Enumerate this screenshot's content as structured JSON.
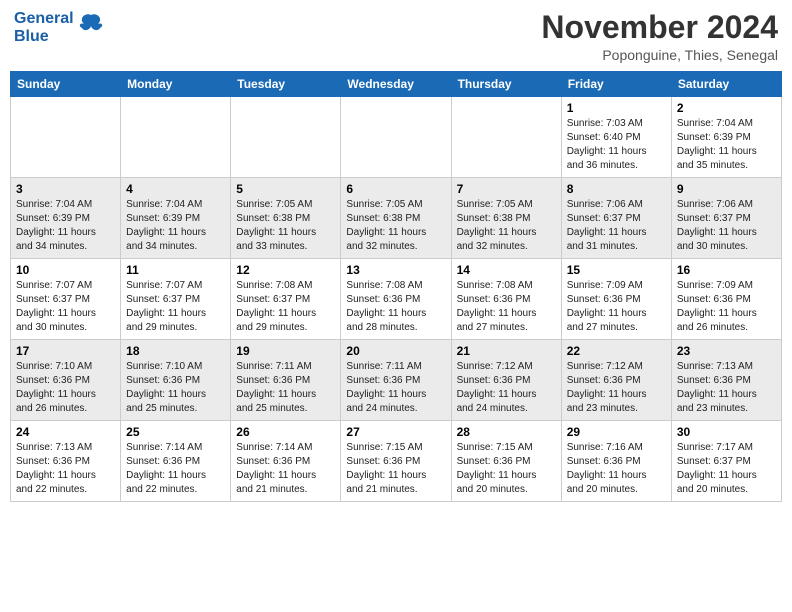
{
  "header": {
    "logo_line1": "General",
    "logo_line2": "Blue",
    "month": "November 2024",
    "location": "Poponguine, Thies, Senegal"
  },
  "days_of_week": [
    "Sunday",
    "Monday",
    "Tuesday",
    "Wednesday",
    "Thursday",
    "Friday",
    "Saturday"
  ],
  "weeks": [
    [
      {
        "day": "",
        "info": ""
      },
      {
        "day": "",
        "info": ""
      },
      {
        "day": "",
        "info": ""
      },
      {
        "day": "",
        "info": ""
      },
      {
        "day": "",
        "info": ""
      },
      {
        "day": "1",
        "info": "Sunrise: 7:03 AM\nSunset: 6:40 PM\nDaylight: 11 hours and 36 minutes."
      },
      {
        "day": "2",
        "info": "Sunrise: 7:04 AM\nSunset: 6:39 PM\nDaylight: 11 hours and 35 minutes."
      }
    ],
    [
      {
        "day": "3",
        "info": "Sunrise: 7:04 AM\nSunset: 6:39 PM\nDaylight: 11 hours and 34 minutes."
      },
      {
        "day": "4",
        "info": "Sunrise: 7:04 AM\nSunset: 6:39 PM\nDaylight: 11 hours and 34 minutes."
      },
      {
        "day": "5",
        "info": "Sunrise: 7:05 AM\nSunset: 6:38 PM\nDaylight: 11 hours and 33 minutes."
      },
      {
        "day": "6",
        "info": "Sunrise: 7:05 AM\nSunset: 6:38 PM\nDaylight: 11 hours and 32 minutes."
      },
      {
        "day": "7",
        "info": "Sunrise: 7:05 AM\nSunset: 6:38 PM\nDaylight: 11 hours and 32 minutes."
      },
      {
        "day": "8",
        "info": "Sunrise: 7:06 AM\nSunset: 6:37 PM\nDaylight: 11 hours and 31 minutes."
      },
      {
        "day": "9",
        "info": "Sunrise: 7:06 AM\nSunset: 6:37 PM\nDaylight: 11 hours and 30 minutes."
      }
    ],
    [
      {
        "day": "10",
        "info": "Sunrise: 7:07 AM\nSunset: 6:37 PM\nDaylight: 11 hours and 30 minutes."
      },
      {
        "day": "11",
        "info": "Sunrise: 7:07 AM\nSunset: 6:37 PM\nDaylight: 11 hours and 29 minutes."
      },
      {
        "day": "12",
        "info": "Sunrise: 7:08 AM\nSunset: 6:37 PM\nDaylight: 11 hours and 29 minutes."
      },
      {
        "day": "13",
        "info": "Sunrise: 7:08 AM\nSunset: 6:36 PM\nDaylight: 11 hours and 28 minutes."
      },
      {
        "day": "14",
        "info": "Sunrise: 7:08 AM\nSunset: 6:36 PM\nDaylight: 11 hours and 27 minutes."
      },
      {
        "day": "15",
        "info": "Sunrise: 7:09 AM\nSunset: 6:36 PM\nDaylight: 11 hours and 27 minutes."
      },
      {
        "day": "16",
        "info": "Sunrise: 7:09 AM\nSunset: 6:36 PM\nDaylight: 11 hours and 26 minutes."
      }
    ],
    [
      {
        "day": "17",
        "info": "Sunrise: 7:10 AM\nSunset: 6:36 PM\nDaylight: 11 hours and 26 minutes."
      },
      {
        "day": "18",
        "info": "Sunrise: 7:10 AM\nSunset: 6:36 PM\nDaylight: 11 hours and 25 minutes."
      },
      {
        "day": "19",
        "info": "Sunrise: 7:11 AM\nSunset: 6:36 PM\nDaylight: 11 hours and 25 minutes."
      },
      {
        "day": "20",
        "info": "Sunrise: 7:11 AM\nSunset: 6:36 PM\nDaylight: 11 hours and 24 minutes."
      },
      {
        "day": "21",
        "info": "Sunrise: 7:12 AM\nSunset: 6:36 PM\nDaylight: 11 hours and 24 minutes."
      },
      {
        "day": "22",
        "info": "Sunrise: 7:12 AM\nSunset: 6:36 PM\nDaylight: 11 hours and 23 minutes."
      },
      {
        "day": "23",
        "info": "Sunrise: 7:13 AM\nSunset: 6:36 PM\nDaylight: 11 hours and 23 minutes."
      }
    ],
    [
      {
        "day": "24",
        "info": "Sunrise: 7:13 AM\nSunset: 6:36 PM\nDaylight: 11 hours and 22 minutes."
      },
      {
        "day": "25",
        "info": "Sunrise: 7:14 AM\nSunset: 6:36 PM\nDaylight: 11 hours and 22 minutes."
      },
      {
        "day": "26",
        "info": "Sunrise: 7:14 AM\nSunset: 6:36 PM\nDaylight: 11 hours and 21 minutes."
      },
      {
        "day": "27",
        "info": "Sunrise: 7:15 AM\nSunset: 6:36 PM\nDaylight: 11 hours and 21 minutes."
      },
      {
        "day": "28",
        "info": "Sunrise: 7:15 AM\nSunset: 6:36 PM\nDaylight: 11 hours and 20 minutes."
      },
      {
        "day": "29",
        "info": "Sunrise: 7:16 AM\nSunset: 6:36 PM\nDaylight: 11 hours and 20 minutes."
      },
      {
        "day": "30",
        "info": "Sunrise: 7:17 AM\nSunset: 6:37 PM\nDaylight: 11 hours and 20 minutes."
      }
    ]
  ]
}
